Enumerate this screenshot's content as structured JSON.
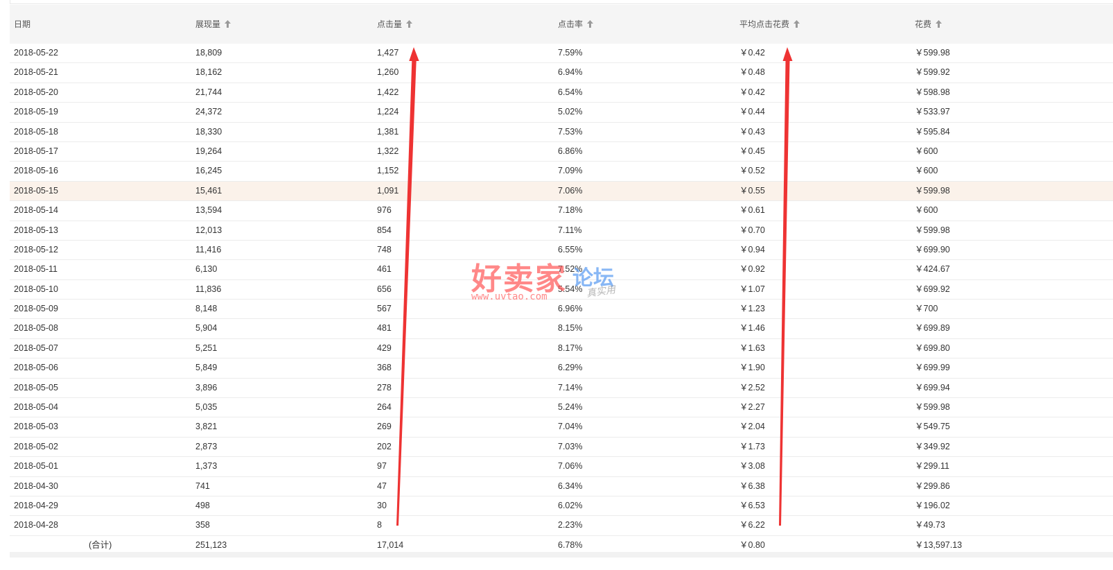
{
  "table": {
    "columns": [
      {
        "label": "日期",
        "sortable": false
      },
      {
        "label": "展现量",
        "sortable": true
      },
      {
        "label": "点击量",
        "sortable": true
      },
      {
        "label": "点击率",
        "sortable": true
      },
      {
        "label": "平均点击花费",
        "sortable": true
      },
      {
        "label": "花费",
        "sortable": true
      }
    ],
    "rows": [
      [
        "2018-05-22",
        "18,809",
        "1,427",
        "7.59%",
        "￥0.42",
        "￥599.98"
      ],
      [
        "2018-05-21",
        "18,162",
        "1,260",
        "6.94%",
        "￥0.48",
        "￥599.92"
      ],
      [
        "2018-05-20",
        "21,744",
        "1,422",
        "6.54%",
        "￥0.42",
        "￥598.98"
      ],
      [
        "2018-05-19",
        "24,372",
        "1,224",
        "5.02%",
        "￥0.44",
        "￥533.97"
      ],
      [
        "2018-05-18",
        "18,330",
        "1,381",
        "7.53%",
        "￥0.43",
        "￥595.84"
      ],
      [
        "2018-05-17",
        "19,264",
        "1,322",
        "6.86%",
        "￥0.45",
        "￥600"
      ],
      [
        "2018-05-16",
        "16,245",
        "1,152",
        "7.09%",
        "￥0.52",
        "￥600"
      ],
      [
        "2018-05-15",
        "15,461",
        "1,091",
        "7.06%",
        "￥0.55",
        "￥599.98"
      ],
      [
        "2018-05-14",
        "13,594",
        "976",
        "7.18%",
        "￥0.61",
        "￥600"
      ],
      [
        "2018-05-13",
        "12,013",
        "854",
        "7.11%",
        "￥0.70",
        "￥599.98"
      ],
      [
        "2018-05-12",
        "11,416",
        "748",
        "6.55%",
        "￥0.94",
        "￥699.90"
      ],
      [
        "2018-05-11",
        "6,130",
        "461",
        "7.52%",
        "￥0.92",
        "￥424.67"
      ],
      [
        "2018-05-10",
        "11,836",
        "656",
        "5.54%",
        "￥1.07",
        "￥699.92"
      ],
      [
        "2018-05-09",
        "8,148",
        "567",
        "6.96%",
        "￥1.23",
        "￥700"
      ],
      [
        "2018-05-08",
        "5,904",
        "481",
        "8.15%",
        "￥1.46",
        "￥699.89"
      ],
      [
        "2018-05-07",
        "5,251",
        "429",
        "8.17%",
        "￥1.63",
        "￥699.80"
      ],
      [
        "2018-05-06",
        "5,849",
        "368",
        "6.29%",
        "￥1.90",
        "￥699.99"
      ],
      [
        "2018-05-05",
        "3,896",
        "278",
        "7.14%",
        "￥2.52",
        "￥699.94"
      ],
      [
        "2018-05-04",
        "5,035",
        "264",
        "5.24%",
        "￥2.27",
        "￥599.98"
      ],
      [
        "2018-05-03",
        "3,821",
        "269",
        "7.04%",
        "￥2.04",
        "￥549.75"
      ],
      [
        "2018-05-02",
        "2,873",
        "202",
        "7.03%",
        "￥1.73",
        "￥349.92"
      ],
      [
        "2018-05-01",
        "1,373",
        "97",
        "7.06%",
        "￥3.08",
        "￥299.11"
      ],
      [
        "2018-04-30",
        "741",
        "47",
        "6.34%",
        "￥6.38",
        "￥299.86"
      ],
      [
        "2018-04-29",
        "498",
        "30",
        "6.02%",
        "￥6.53",
        "￥196.02"
      ],
      [
        "2018-04-28",
        "358",
        "8",
        "2.23%",
        "￥6.22",
        "￥49.73"
      ]
    ],
    "highlighted_row": 7,
    "total": [
      "(合计)",
      "251,123",
      "17,014",
      "6.78%",
      "￥0.80",
      "￥13,597.13"
    ]
  },
  "watermark": {
    "brand": "好卖家",
    "forum": "论坛",
    "url": "www.uvtao.com",
    "tagline": "真实用"
  },
  "colors": {
    "header_bg": "#f5f5f5",
    "row_border": "#ececec",
    "highlight_bg": "#fbf2ea",
    "annotation_arrow": "#ee3333",
    "sort_icon": "#9a9a9a"
  }
}
